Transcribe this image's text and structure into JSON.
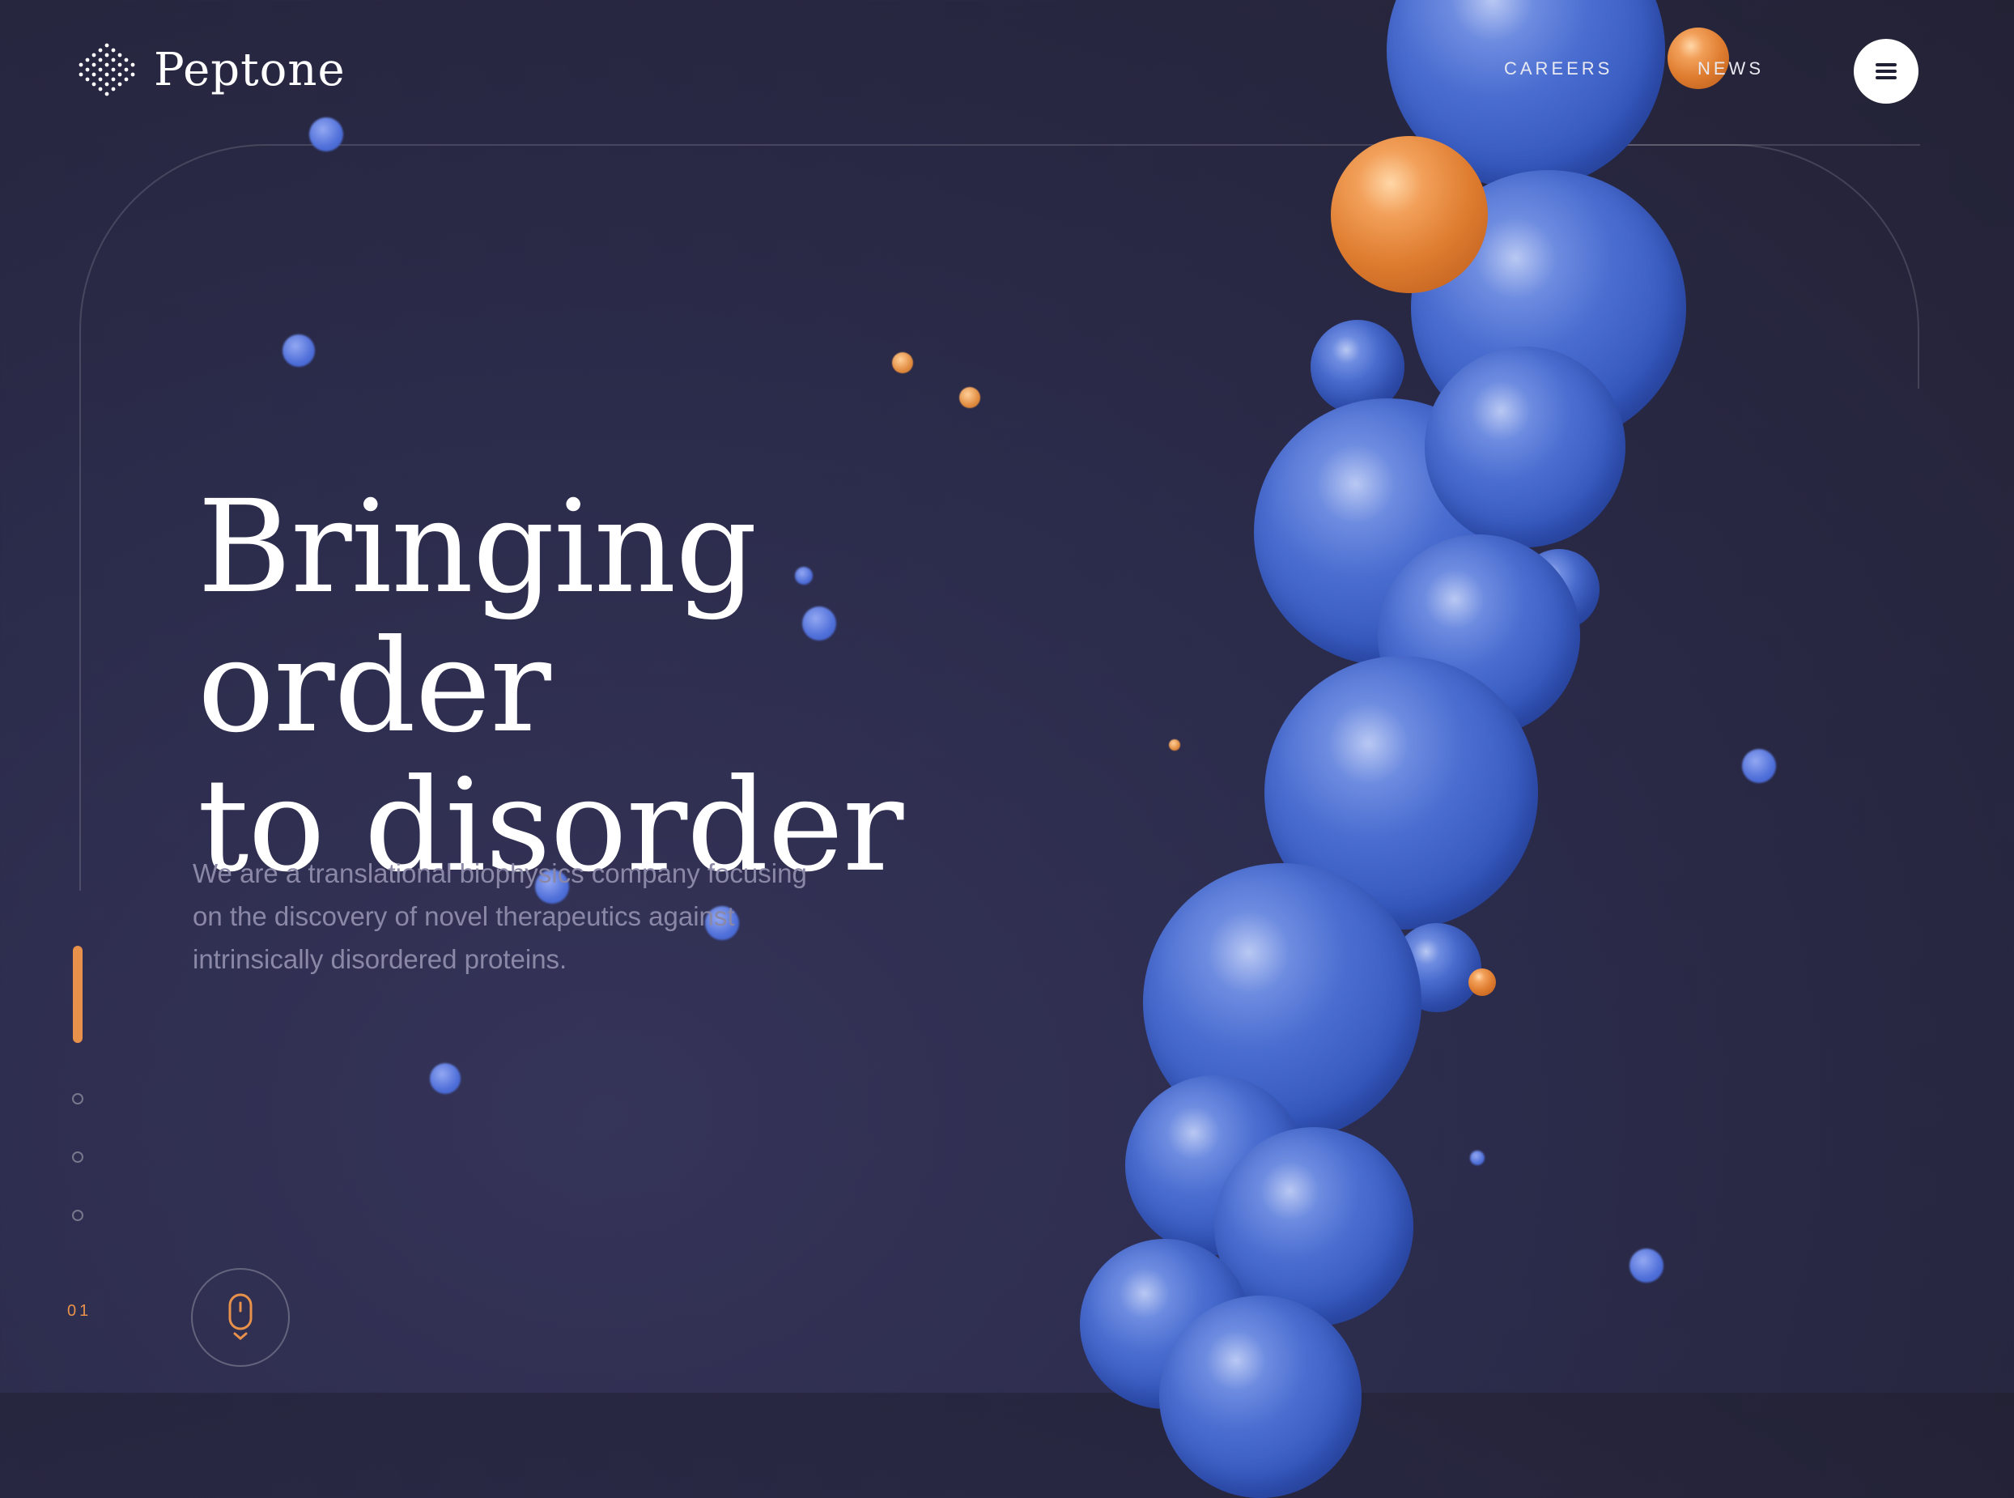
{
  "brand": {
    "name": "Peptone"
  },
  "nav": {
    "careers": "CAREERS",
    "news": "NEWS",
    "menu_icon": "hamburger-icon"
  },
  "hero": {
    "title_line1": "Bringing order",
    "title_line2": "to disorder",
    "description": "We are a translational biophysics company focusing on the discovery of novel therapeutics against intrinsically disordered proteins."
  },
  "slider": {
    "current": "01",
    "total_dots": 4,
    "active_index": 0
  },
  "scroll": {
    "icon": "mouse-scroll-icon"
  },
  "colors": {
    "accent": "#e8914a",
    "background": "#2b2b4b",
    "sphere_blue": "#4a6dd0",
    "sphere_orange": "#de7c2f"
  }
}
